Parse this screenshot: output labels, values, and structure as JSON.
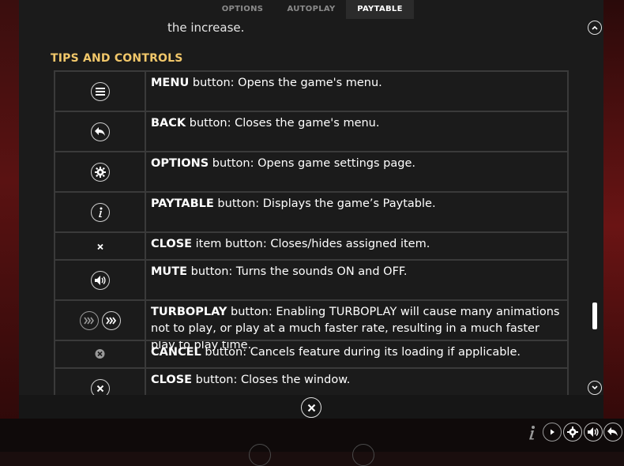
{
  "tabs": [
    {
      "label": "OPTIONS",
      "active": false
    },
    {
      "label": "AUTOPLAY",
      "active": false
    },
    {
      "label": "PAYTABLE",
      "active": true
    }
  ],
  "intro_text": "the increase.",
  "section_title": "TIPS AND CONTROLS",
  "rows": [
    {
      "icon": "menu-icon",
      "bold": "MENU",
      "text": " button: Opens the game's menu."
    },
    {
      "icon": "back-icon",
      "bold": "BACK",
      "text": " button: Closes the game's menu."
    },
    {
      "icon": "gear-icon",
      "bold": "OPTIONS",
      "text": " button: Opens game settings page."
    },
    {
      "icon": "info-icon",
      "bold": "PAYTABLE",
      "text": " button: Displays the game’s Paytable."
    },
    {
      "icon": "close-small-icon",
      "bold": "CLOSE",
      "text": " item button: Closes/hides assigned item."
    },
    {
      "icon": "speaker-icon",
      "bold": "MUTE",
      "text": " button: Turns the sounds ON and OFF."
    },
    {
      "icon": "turboplay-icon",
      "bold": "TURBOPLAY",
      "text": " button: Enabling TURBOPLAY will cause many animations not to play, or play at a much faster rate, resulting in a much faster play to play time."
    },
    {
      "icon": "cancel-icon",
      "bold": "CANCEL",
      "text": " button: Cancels feature during its loading if applicable."
    },
    {
      "icon": "close-circle-icon",
      "bold": "CLOSE",
      "text": " button: Closes the window."
    }
  ],
  "colors": {
    "accent": "#f1c76a",
    "panel": "#1b1b1b",
    "border": "#3a3a3a"
  }
}
